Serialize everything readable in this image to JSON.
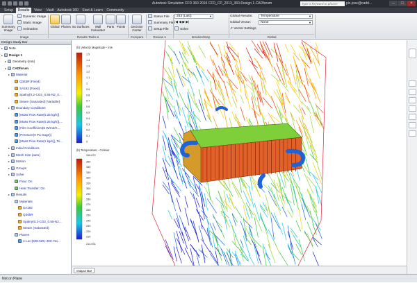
{
  "window": {
    "title": "Autodesk Simulation CFD 360 2016   CFD_CP_2013_360-Design 1-CADforum",
    "search_placeholder": "Type a keyword or phrase",
    "user": "pis.jose@cadd...",
    "minimize": "–",
    "maximize": "□",
    "close": "×"
  },
  "tabs": [
    "Setup",
    "Results",
    "View",
    "Vault",
    "Autodesk 360",
    "Start & Learn",
    "Community"
  ],
  "active_tab": "Results",
  "ribbon": {
    "summary_image": "Summary Image",
    "dynamic_image": "Dynamic Image",
    "static_image": "Static Image",
    "animation": "Animation",
    "image_group": "Image",
    "global": "Global",
    "planes": "Planes",
    "iso_surfaces": "Iso Surfaces",
    "wall_calculator": "Wall Calculator",
    "parts": "Parts",
    "points": "Points",
    "results_tasks_group": "Results Tasks ▾",
    "decision_center": "Decision Center",
    "compare_group": "Compare",
    "status_file": "Status File",
    "summary_file": "Summary File",
    "setup_file": "Setup File",
    "review_group": "Review ▾",
    "iteration_value": "253 (Last)",
    "solve": "Solve",
    "iteration_group": "Iteration/Step",
    "global_results_label": "Global Results:",
    "global_results_value": "Temperature",
    "global_vector_label": "Global Vector:",
    "global_vector_value": "None",
    "vector_settings": "Vector Settings",
    "global_group": "Global"
  },
  "panel": {
    "title": "Design Study Bar",
    "tree": [
      {
        "label": "Note",
        "level": 1,
        "kind": "plain"
      },
      {
        "label": "Design 1",
        "level": 1,
        "kind": "root"
      },
      {
        "label": "Geometry (mm)",
        "level": 2,
        "kind": "plain"
      },
      {
        "label": "CADforum",
        "level": 2,
        "kind": "root"
      },
      {
        "label": "Material",
        "level": 3,
        "kind": "link"
      },
      {
        "label": "Q345R [Fixed]",
        "level": 4,
        "kind": "mat"
      },
      {
        "label": "SA192 [Fixed]",
        "level": 4,
        "kind": "mat"
      },
      {
        "label": "Spalny(0.2-CO2_0.55-N2_0...",
        "level": 4,
        "kind": "mat"
      },
      {
        "label": "Steam (Saturated) [Variable]",
        "level": 4,
        "kind": "mat"
      },
      {
        "label": "Boundary Conditions",
        "level": 3,
        "kind": "link"
      },
      {
        "label": "[Mass Flow Rate(0.25 kg/s)]",
        "level": 4,
        "kind": "bc"
      },
      {
        "label": "[Mass Flow Rate(0.25 kg/s)],...",
        "level": 4,
        "kind": "bc"
      },
      {
        "label": "[Film Coefficient(5 W/m2/K...",
        "level": 4,
        "kind": "bc"
      },
      {
        "label": "[Pressure(0 Pa Gage)]",
        "level": 4,
        "kind": "bc"
      },
      {
        "label": "[Mass Flow Rate(1 kg/s)], Te...",
        "level": 4,
        "kind": "bc"
      },
      {
        "label": "Initial Conditions",
        "level": 3,
        "kind": "link"
      },
      {
        "label": "Mesh Size (auto)",
        "level": 3,
        "kind": "link"
      },
      {
        "label": "Motion",
        "level": 3,
        "kind": "link"
      },
      {
        "label": "Groups",
        "level": 3,
        "kind": "link"
      },
      {
        "label": "Solve",
        "level": 3,
        "kind": "link"
      },
      {
        "label": "Flow: On",
        "level": 4,
        "kind": "grn"
      },
      {
        "label": "Heat Transfer: On",
        "level": 4,
        "kind": "grn"
      },
      {
        "label": "Results",
        "level": 3,
        "kind": "link"
      },
      {
        "label": "Materials",
        "level": 4,
        "kind": "link"
      },
      {
        "label": "SA192",
        "level": 5,
        "kind": "mat"
      },
      {
        "label": "Q345R",
        "level": 5,
        "kind": "mat"
      },
      {
        "label": "Spalny(0.2-CO2_0.55-N2...",
        "level": 5,
        "kind": "mat"
      },
      {
        "label": "Steam (Saturated)",
        "level": 5,
        "kind": "mat"
      },
      {
        "label": "Planes",
        "level": 4,
        "kind": "link"
      },
      {
        "label": "1-Loc:(600.525;-400:-No...",
        "level": 5,
        "kind": "bc"
      }
    ]
  },
  "velocity_legend": {
    "title": "(b) Velocity Magnitude - m/s",
    "ticks": [
      "1.5",
      "1.4",
      "1.3",
      "1.2",
      "1.1",
      "1",
      "0.9",
      "0.8",
      "0.7",
      "0.6",
      "0.5",
      "0.4",
      "0.3",
      "0.2",
      "0.1",
      "0"
    ]
  },
  "temperature_legend": {
    "title": "(b) Temperature - Celsius",
    "max": "316.672",
    "ticks": [
      "350",
      "340",
      "330",
      "320",
      "310",
      "300",
      "290",
      "280",
      "270",
      "260",
      "250",
      "240",
      "230",
      "220",
      "210"
    ],
    "min": "214.931"
  },
  "output_bar": "Output Bar",
  "status": "Not on Plane",
  "colors": {
    "hot": "#d21c0c",
    "cold": "#1030d8",
    "ribbon_selected": "#f4c65a"
  }
}
